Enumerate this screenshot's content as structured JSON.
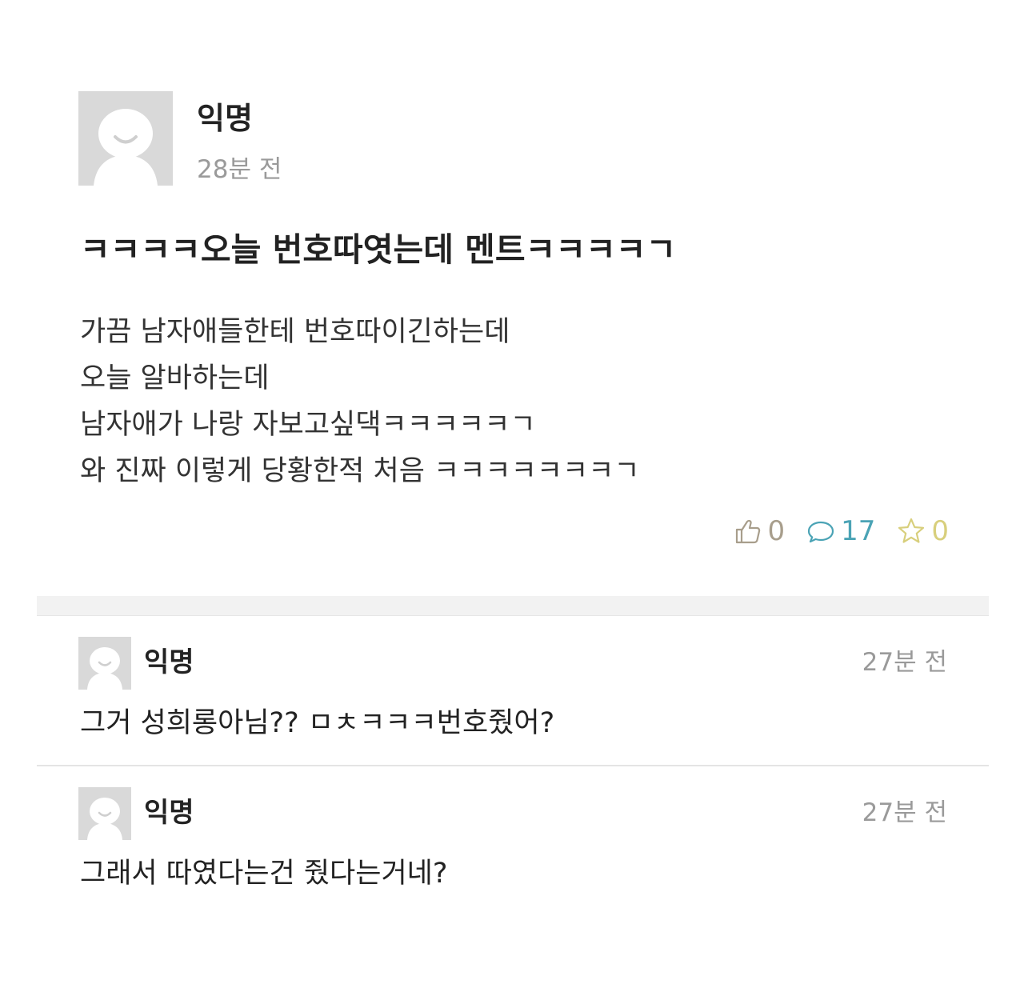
{
  "post": {
    "author": "익명",
    "time": "28분 전",
    "avatar_icon": "anonymous-user-icon",
    "title": "ㅋㅋㅋㅋ오늘 번호따엿는데 멘트ㅋㅋㅋㅋㄱ",
    "body_lines": [
      "가끔 남자애들한테 번호따이긴하는데",
      "오늘 알바하는데",
      "남자애가 나랑 자보고싶댁ㅋㅋㅋㅋㅋㄱ",
      "와 진짜 이렇게 당황한적 처음 ㅋㅋㅋㅋㅋㅋㅋㄱ"
    ],
    "stats": {
      "likes": "0",
      "comments": "17",
      "scraps": "0"
    }
  },
  "comments": [
    {
      "author": "익명",
      "time": "27분 전",
      "text": "그거 성희롱아님?? ㅁㅊㅋㅋㅋ번호줬어?"
    },
    {
      "author": "익명",
      "time": "27분 전",
      "text": "그래서 따였다는건 줬다는거네?"
    }
  ],
  "colors": {
    "avatar_bg": "#d9d9d9",
    "like": "#a89e8c",
    "comment": "#4aa3b5",
    "scrap": "#d8cf7c",
    "time": "#9a9a9a"
  }
}
